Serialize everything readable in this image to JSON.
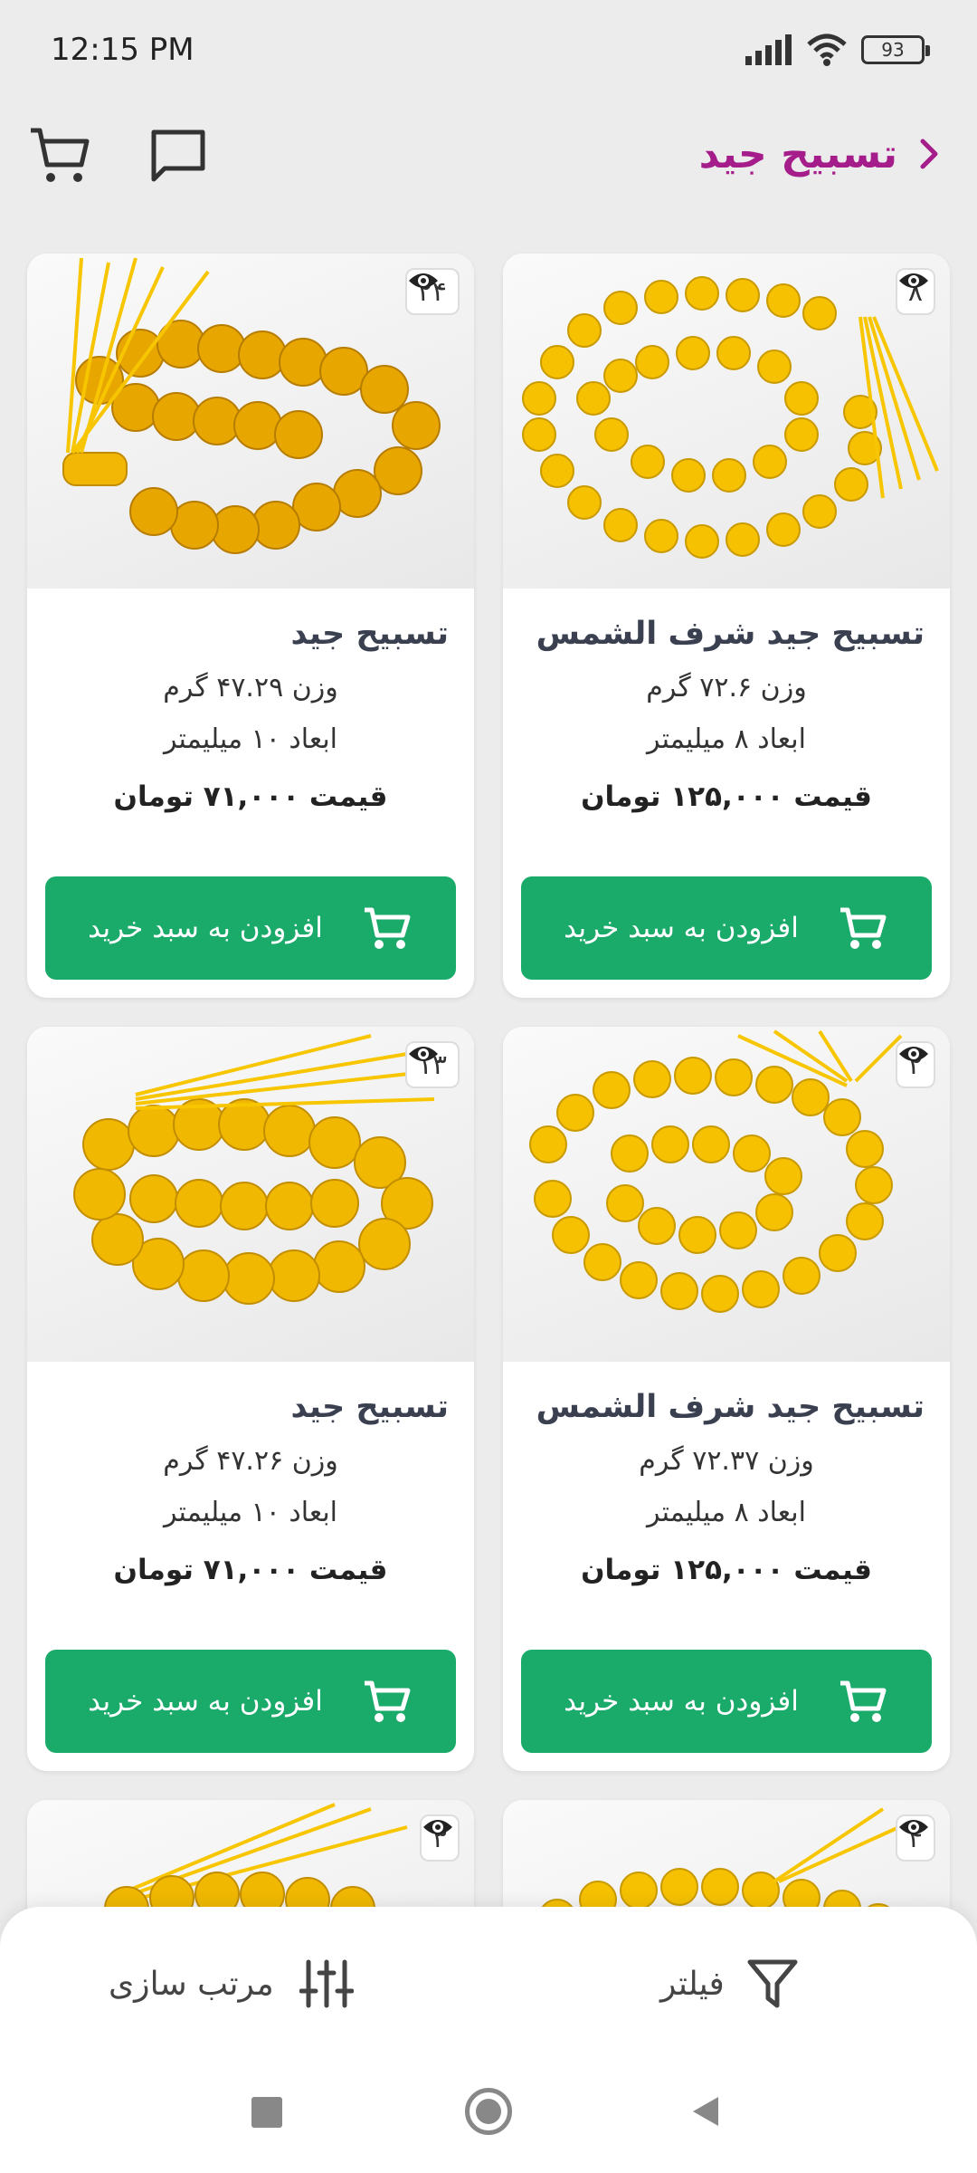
{
  "status": {
    "time": "12:15 PM",
    "battery": "93"
  },
  "header": {
    "title": "تسبیح جید"
  },
  "products": [
    {
      "title": "تسبیح جید",
      "weight": "وزن ۴۷.۲۹ گرم",
      "size": "ابعاد ۱۰ میلیمتر",
      "price": "قیمت ۷۱,۰۰۰ تومان",
      "views": "۲۴",
      "button": "افزودن به سبد خرید"
    },
    {
      "title": "تسبیح جید شرف الشمس",
      "weight": "وزن ۷۲.۶ گرم",
      "size": "ابعاد ۸ میلیمتر",
      "price": "قیمت ۱۲۵,۰۰۰ تومان",
      "views": "۸",
      "button": "افزودن به سبد خرید"
    },
    {
      "title": "تسبیح جید",
      "weight": "وزن ۴۷.۲۶ گرم",
      "size": "ابعاد ۱۰ میلیمتر",
      "price": "قیمت ۷۱,۰۰۰ تومان",
      "views": "۱۳",
      "button": "افزودن به سبد خرید"
    },
    {
      "title": "تسبیح جید شرف الشمس",
      "weight": "وزن ۷۲.۳۷ گرم",
      "size": "ابعاد ۸ میلیمتر",
      "price": "قیمت ۱۲۵,۰۰۰ تومان",
      "views": "۲",
      "button": "افزودن به سبد خرید"
    },
    {
      "views": "۳"
    },
    {
      "views": "۴"
    }
  ],
  "bottom": {
    "sort_label": "مرتب سازی",
    "filter_label": "فیلتر"
  },
  "colors": {
    "accent": "#a51d8a",
    "button": "#1aaa6a",
    "bead": "#f2b705"
  }
}
